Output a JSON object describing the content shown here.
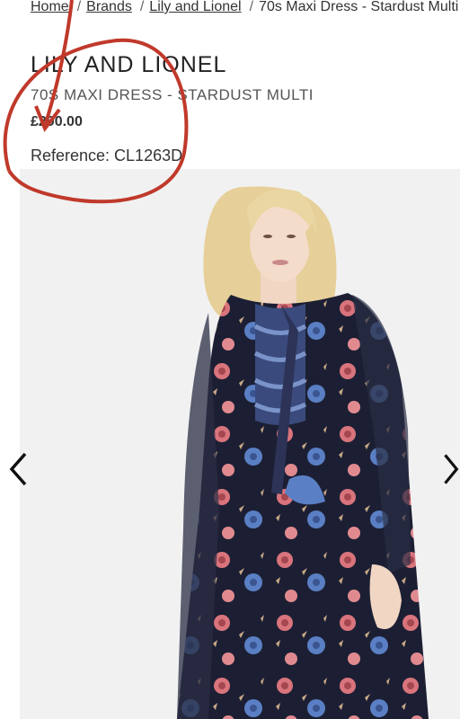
{
  "breadcrumb": {
    "home": "Home",
    "brands": "Brands",
    "brand": "Lily and Lionel",
    "current": "70s Maxi Dress - Stardust Multi"
  },
  "product": {
    "brand": "LILY AND LIONEL",
    "name": "70S MAXI DRESS - STARDUST MULTI",
    "price": "£290.00",
    "reference": "Reference: CL1263D"
  },
  "gallery": {
    "prev_icon": "chevron-left-icon",
    "next_icon": "chevron-right-icon"
  },
  "colors": {
    "annotation": "#c0392b",
    "dress": "#1c1f33",
    "hair": "#e6cf98"
  }
}
